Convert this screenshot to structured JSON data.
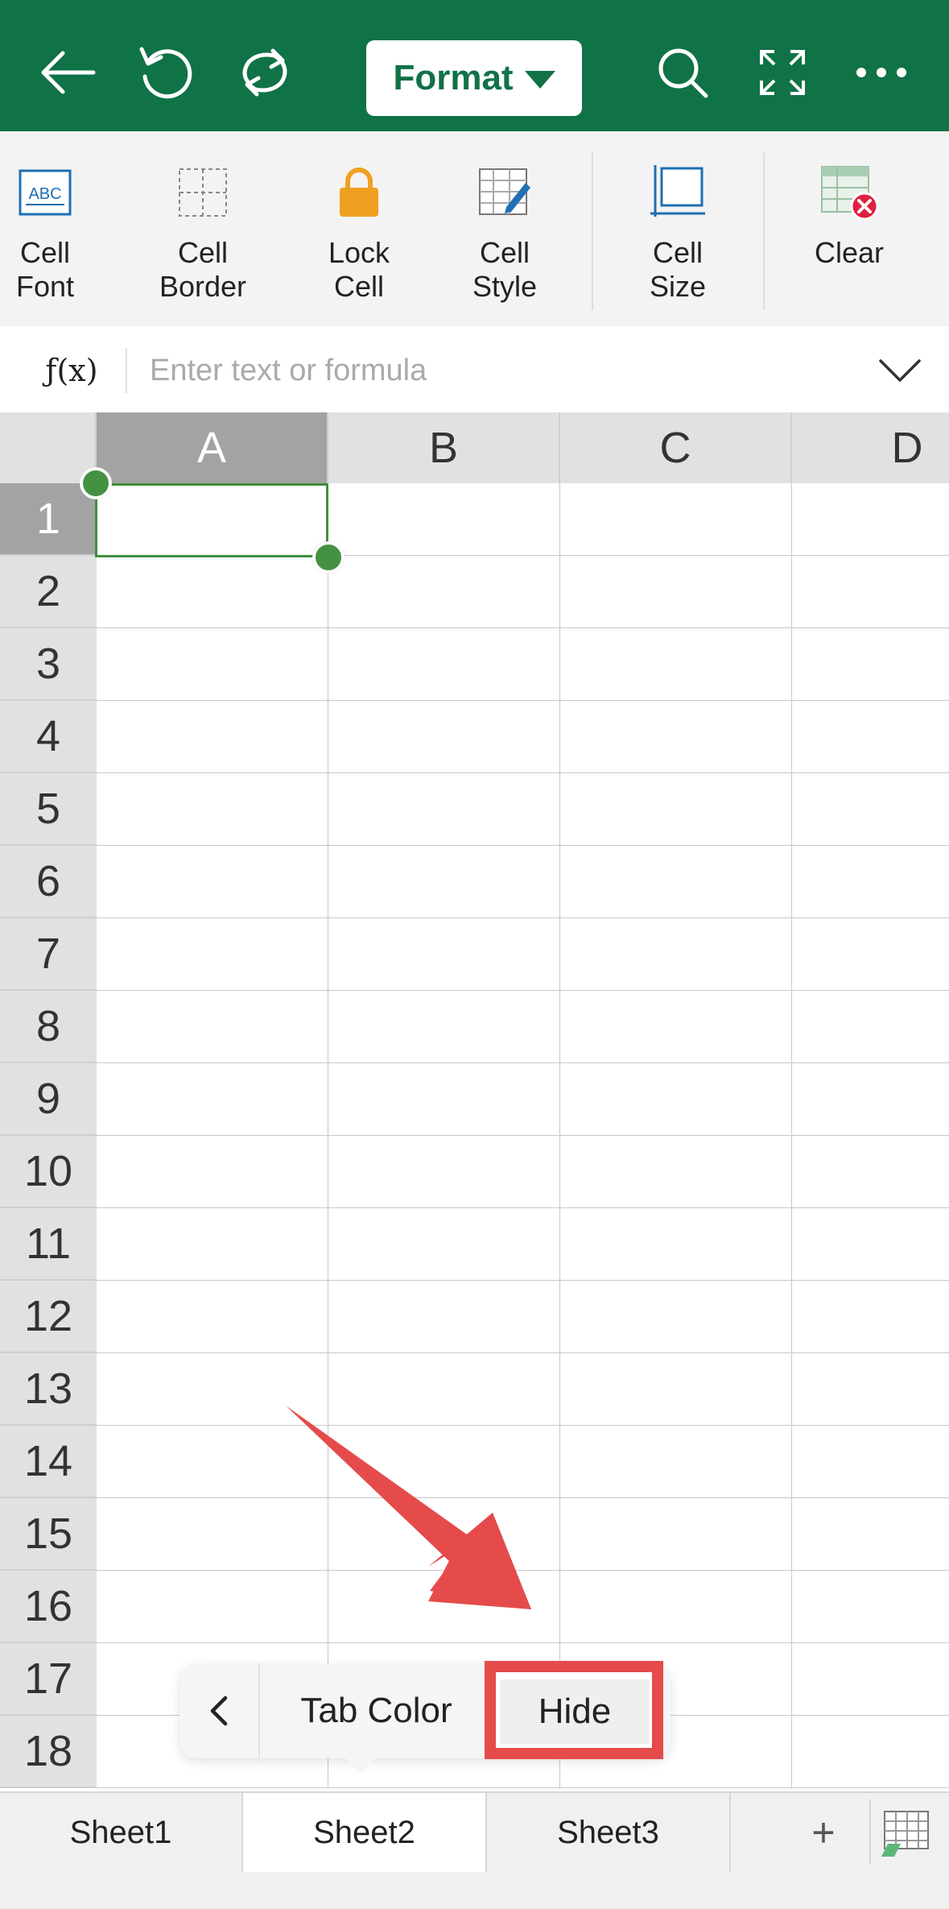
{
  "toolbar": {
    "format_label": "Format",
    "icons": [
      "back-arrow-icon",
      "undo-icon",
      "redo-icon",
      "search-icon",
      "fullscreen-icon",
      "more-icon"
    ]
  },
  "ribbon": {
    "items": [
      {
        "label": "Cell\nFont",
        "icon": "cell-font-icon"
      },
      {
        "label": "Cell\nBorder",
        "icon": "cell-border-icon"
      },
      {
        "label": "Lock\nCell",
        "icon": "lock-icon"
      },
      {
        "label": "Cell\nStyle",
        "icon": "cell-style-icon"
      },
      {
        "label": "Cell\nSize",
        "icon": "cell-size-icon"
      },
      {
        "label": "Clear",
        "icon": "clear-icon"
      }
    ]
  },
  "formula": {
    "fx_label": "ƒ(x)",
    "placeholder": "Enter text or formula",
    "value": ""
  },
  "grid": {
    "columns": [
      "A",
      "B",
      "C",
      "D"
    ],
    "rows": [
      "1",
      "2",
      "3",
      "4",
      "5",
      "6",
      "7",
      "8",
      "9",
      "10",
      "11",
      "12",
      "13",
      "14",
      "15",
      "16",
      "17",
      "18"
    ],
    "selected_cell": "A1"
  },
  "popup": {
    "tab_color_label": "Tab Color",
    "hide_label": "Hide"
  },
  "sheets": {
    "tabs": [
      "Sheet1",
      "Sheet2",
      "Sheet3"
    ],
    "active": "Sheet2",
    "add_label": "+"
  },
  "colors": {
    "brand_green": "#107247",
    "selection_green": "#459144",
    "annotation_red": "#e54b4b",
    "lock_orange": "#f0a020"
  }
}
